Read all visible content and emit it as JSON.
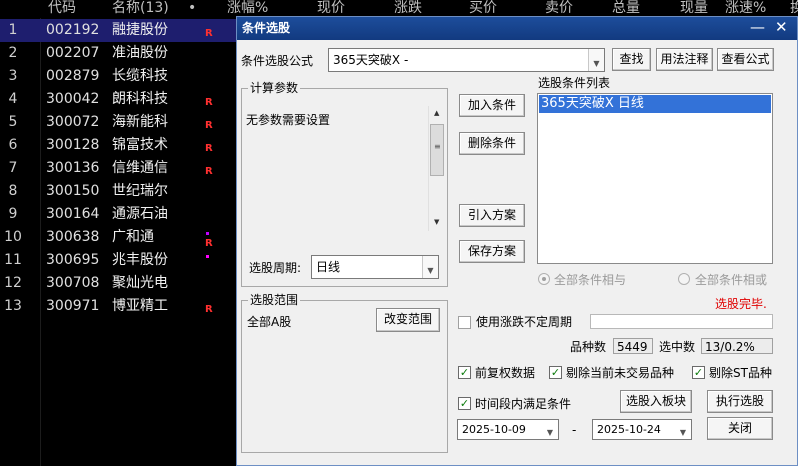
{
  "header": {
    "columns": [
      "代码",
      "名称(13)",
      "•",
      "涨幅%",
      "现价",
      "涨跌",
      "买价",
      "卖价",
      "总量",
      "现量",
      "涨速%",
      "换"
    ]
  },
  "stocks": [
    {
      "idx": "1",
      "code": "002192",
      "name": "融捷股份",
      "mark": "R"
    },
    {
      "idx": "2",
      "code": "002207",
      "name": "准油股份",
      "mark": ""
    },
    {
      "idx": "3",
      "code": "002879",
      "name": "长缆科技",
      "mark": ""
    },
    {
      "idx": "4",
      "code": "300042",
      "name": "朗科科技",
      "mark": "R"
    },
    {
      "idx": "5",
      "code": "300072",
      "name": "海新能科",
      "mark": "R"
    },
    {
      "idx": "6",
      "code": "300128",
      "name": "锦富技术",
      "mark": "R"
    },
    {
      "idx": "7",
      "code": "300136",
      "name": "信维通信",
      "mark": "R"
    },
    {
      "idx": "8",
      "code": "300150",
      "name": "世纪瑞尔",
      "mark": ""
    },
    {
      "idx": "9",
      "code": "300164",
      "name": "通源石油",
      "mark": ""
    },
    {
      "idx": "10",
      "code": "300638",
      "name": "广和通",
      "mark": "R"
    },
    {
      "idx": "11",
      "code": "300695",
      "name": "兆丰股份",
      "mark": ""
    },
    {
      "idx": "12",
      "code": "300708",
      "name": "聚灿光电",
      "mark": ""
    },
    {
      "idx": "13",
      "code": "300971",
      "name": "博亚精工",
      "mark": "R"
    }
  ],
  "dialog": {
    "title": "条件选股",
    "minimize": "—",
    "close": "✕",
    "formula_label": "条件选股公式",
    "formula_value": "365天突破X  -",
    "find_btn": "查找",
    "usage_btn": "用法注释",
    "view_formula_btn": "查看公式",
    "params_group": "计算参数",
    "params_text": "无参数需要设置",
    "period_label": "选股周期:",
    "period_value": "日线",
    "add_btn": "加入条件",
    "delete_btn": "删除条件",
    "import_btn": "引入方案",
    "save_btn": "保存方案",
    "list_label": "选股条件列表",
    "list_items": [
      "365天突破X  日线"
    ],
    "radio_and": "全部条件相与",
    "radio_or": "全部条件相或",
    "status": "选股完毕.",
    "scope_group": "选股范围",
    "scope_text": "全部A股",
    "change_scope_btn": "改变范围",
    "use_uncertain_label": "使用涨跌不定周期",
    "uncertain_value": "",
    "variety_label": "品种数",
    "variety_value": "5449",
    "selected_label": "选中数",
    "selected_value": "13/0.2%",
    "adjust_label": "前复权数据",
    "exclude_untraded_label": "剔除当前未交易品种",
    "exclude_st_label": "剔除ST品种",
    "time_condition_label": "时间段内满足条件",
    "to_block_btn": "选股入板块",
    "execute_btn": "执行选股",
    "date_from": "2025-10-09",
    "date_sep": "-",
    "date_to": "2025-10-24",
    "close_btn": "关闭"
  },
  "colors": {
    "title_bar": "#1d4d9b",
    "list_selection": "#3372d8",
    "status_red": "#e00000",
    "stock_mark_red": "#ff3030"
  }
}
